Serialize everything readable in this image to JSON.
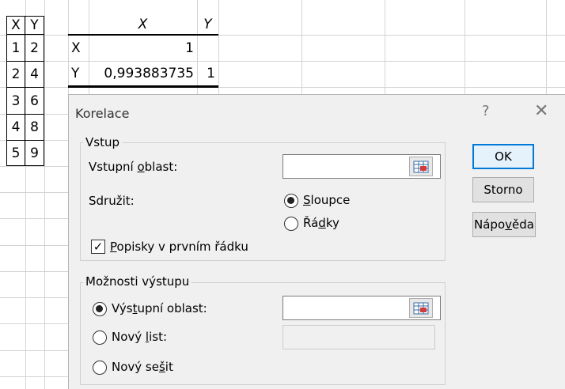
{
  "sheet": {
    "data_header": [
      "X",
      "Y"
    ],
    "data_rows": [
      [
        "1",
        "2"
      ],
      [
        "2",
        "4"
      ],
      [
        "3",
        "6"
      ],
      [
        "4",
        "8"
      ],
      [
        "5",
        "9"
      ]
    ],
    "corr_header": [
      "X",
      "Y"
    ],
    "corr_rows": [
      {
        "label": "X",
        "values": [
          "1",
          ""
        ]
      },
      {
        "label": "Y",
        "values": [
          "0,993883735",
          "1"
        ]
      }
    ]
  },
  "dialog": {
    "title": "Korelace",
    "help_glyph": "?",
    "close_glyph": "✕",
    "input_group": {
      "legend": "Vstup",
      "range_label_pre": "Vstupní ",
      "range_label_u": "o",
      "range_label_post": "blast:",
      "range_value": "",
      "group_label": "Sdružit:",
      "columns_u": "S",
      "columns_rest": "loupce",
      "columns_selected": true,
      "rows_pre": "Řá",
      "rows_u": "d",
      "rows_post": "ky",
      "labels_u": "P",
      "labels_rest": "opisky v prvním řádku",
      "labels_checked": true,
      "check_glyph": "✓"
    },
    "output_group": {
      "legend": "Možnosti výstupu",
      "out_range_pre": "Výs",
      "out_range_u": "t",
      "out_range_post": "upní oblast:",
      "out_range_selected": true,
      "out_range_value": "",
      "new_sheet_pre": "Nový ",
      "new_sheet_u": "l",
      "new_sheet_post": "ist:",
      "new_sheet_value": "",
      "new_book_pre": "Nový se",
      "new_book_u": "š",
      "new_book_post": "it"
    },
    "buttons": {
      "ok": "OK",
      "cancel": "Storno",
      "help_pre": "Nápo",
      "help_u": "v",
      "help_post": "ěda"
    },
    "icons": {
      "range_selector": "range-selector-icon",
      "accent": "#0078d7"
    }
  }
}
